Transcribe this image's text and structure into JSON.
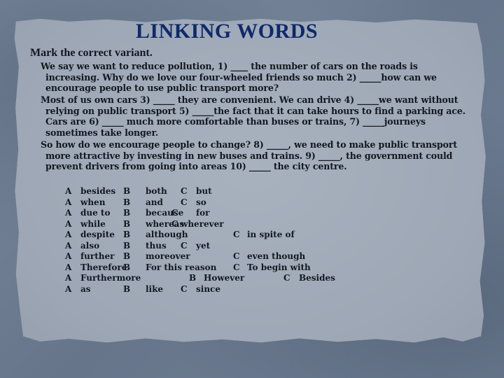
{
  "title": "LINKING WORDS",
  "instruction": "Mark the correct variant.",
  "paragraphs": {
    "p1": [
      "We say we want to reduce pollution, 1) ____ the number of cars on the roads is",
      "increasing. Why do we love our four-wheeled friends so much 2) _____how can we",
      "encourage people to use public transport more?"
    ],
    "p2": [
      "Most of us own cars 3) _____ they are convenient. We can drive 4) _____we want without",
      "relying on public transport 5) _____the fact that it can take hours to find a parking ace.",
      "Cars are 6) _____ much more comfortable than buses or trains, 7) _____journeys",
      "sometimes take longer."
    ],
    "p3": [
      "So how do we encourage people to change? 8) _____, we need to make public transport",
      "more attractive by investing in new buses and trains. 9) _____, the government could",
      "prevent drivers from going into areas 10) _____ the city centre."
    ]
  },
  "options": [
    {
      "a_letter": "A",
      "a": "besides",
      "b_letter": "B",
      "b": "both",
      "c_letter": "C",
      "c": "but"
    },
    {
      "a_letter": "A",
      "a": "when",
      "b_letter": "B",
      "b": "and",
      "c_letter": "C",
      "c": "so"
    },
    {
      "a_letter": "A",
      "a": "due to",
      "b_letter": "B",
      "b": "because",
      "c_letter": "C",
      "c": "for"
    },
    {
      "a_letter": "A",
      "a": "while",
      "b_letter": "B",
      "b": "whereas",
      "c_letter": "C",
      "c": "wherever"
    },
    {
      "a_letter": "A",
      "a": "despite",
      "b_letter": "B",
      "b": "although",
      "c_letter": "C",
      "c": "in spite of"
    },
    {
      "a_letter": "A",
      "a": "also",
      "b_letter": "B",
      "b": "thus",
      "c_letter": "C",
      "c": "yet"
    },
    {
      "a_letter": "A",
      "a": "further",
      "b_letter": "B",
      "b": "moreover",
      "c_letter": "C",
      "c": "even though"
    },
    {
      "a_letter": "A",
      "a": "Therefore",
      "b_letter": "B",
      "b": "For this reason",
      "c_letter": "C",
      "c": "To begin with"
    },
    {
      "a_letter": "A",
      "a": "Furthermore",
      "b_letter": "B",
      "b": "However",
      "c_letter": "C",
      "c": "Besides"
    },
    {
      "a_letter": "A",
      "a": "as",
      "b_letter": "B",
      "b": "like",
      "c_letter": "C",
      "c": "since"
    }
  ],
  "colors": {
    "title": "#0e2a6b",
    "text": "#121820",
    "paper": "#a3acb9",
    "background": "#6e7d92"
  }
}
